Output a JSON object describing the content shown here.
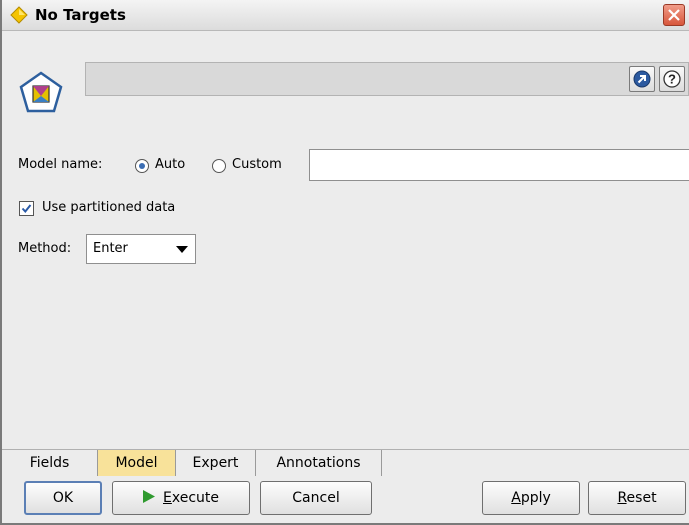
{
  "window": {
    "title": "No Targets"
  },
  "icons": {
    "title": "yellow-diamond-icon",
    "node": "pentagon-model-node-icon",
    "close": "close-icon",
    "expand": "launch-icon",
    "help": "help-icon",
    "execute": "play-icon",
    "dropdown": "chevron-down-icon"
  },
  "colors": {
    "active_tab": "#f8e29a",
    "accent": "#3b6db3",
    "close": "#d7563b",
    "play": "#2f9a2f"
  },
  "model_name": {
    "label": "Model name:",
    "option_auto": "Auto",
    "option_custom": "Custom",
    "selected": "Auto",
    "custom_value": ""
  },
  "partition": {
    "label": "Use partitioned data",
    "checked": true
  },
  "method": {
    "label": "Method:",
    "value": "Enter"
  },
  "tabs": [
    {
      "label": "Fields",
      "active": false
    },
    {
      "label": "Model",
      "active": true
    },
    {
      "label": "Expert",
      "active": false
    },
    {
      "label": "Annotations",
      "active": false
    }
  ],
  "buttons": {
    "ok": "OK",
    "execute": {
      "mnemonic": "E",
      "rest": "xecute"
    },
    "cancel": "Cancel",
    "apply": {
      "mnemonic": "A",
      "rest": "pply"
    },
    "reset": {
      "mnemonic": "R",
      "rest": "eset"
    }
  }
}
